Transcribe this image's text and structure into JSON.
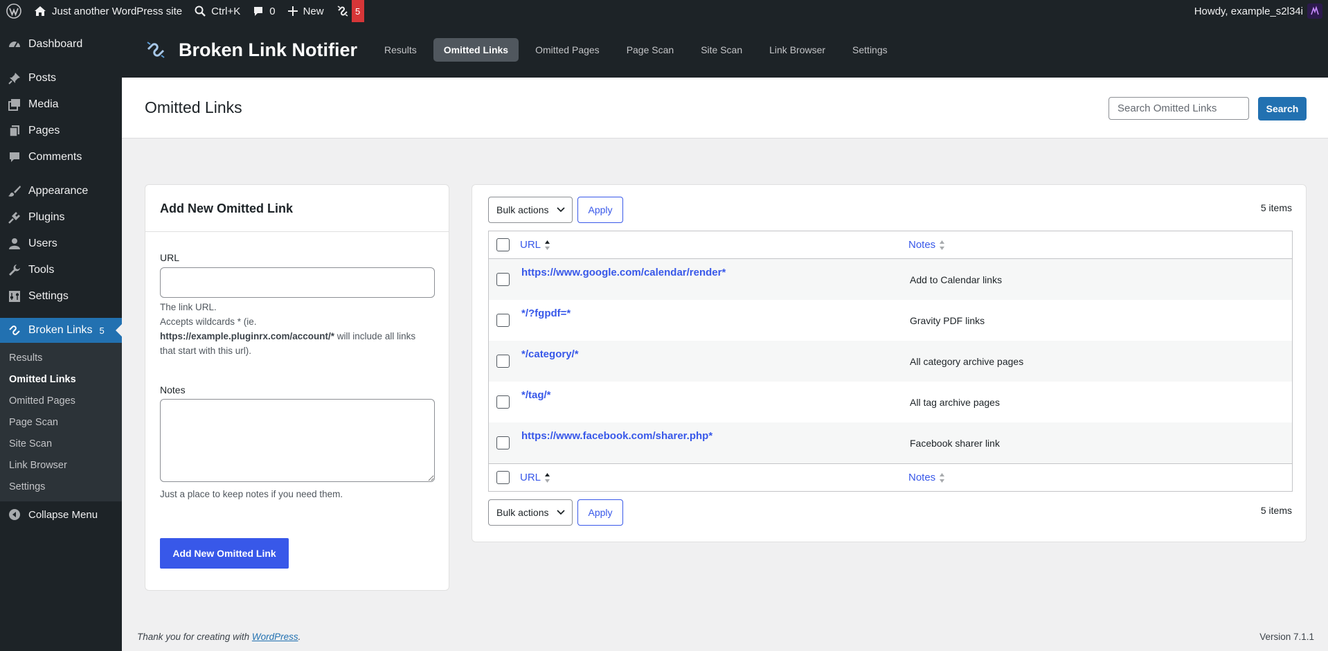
{
  "adminbar": {
    "site_name": "Just another WordPress site",
    "search_shortcut": "Ctrl+K",
    "comments_count": "0",
    "new_label": "New",
    "plugin_badge": "5",
    "howdy": "Howdy, example_s2l34i"
  },
  "menu": {
    "items": [
      {
        "label": "Dashboard",
        "icon": "dashboard-icon"
      },
      {
        "label": "Posts",
        "icon": "pin-icon"
      },
      {
        "label": "Media",
        "icon": "media-icon"
      },
      {
        "label": "Pages",
        "icon": "pages-icon"
      },
      {
        "label": "Comments",
        "icon": "comments-icon"
      },
      {
        "label": "Appearance",
        "icon": "brush-icon"
      },
      {
        "label": "Plugins",
        "icon": "plug-icon"
      },
      {
        "label": "Users",
        "icon": "user-icon"
      },
      {
        "label": "Tools",
        "icon": "wrench-icon"
      },
      {
        "label": "Settings",
        "icon": "sliders-icon"
      }
    ],
    "current": {
      "label": "Broken Links",
      "count": "5"
    },
    "submenu": [
      "Results",
      "Omitted Links",
      "Omitted Pages",
      "Page Scan",
      "Site Scan",
      "Link Browser",
      "Settings"
    ],
    "collapse": "Collapse Menu"
  },
  "plugin_header": {
    "title": "Broken Link Notifier",
    "tabs": [
      "Results",
      "Omitted Links",
      "Omitted Pages",
      "Page Scan",
      "Site Scan",
      "Link Browser",
      "Settings"
    ],
    "active_tab": "Omitted Links"
  },
  "page": {
    "title": "Omitted Links",
    "search_placeholder": "Search Omitted Links",
    "search_button": "Search"
  },
  "form": {
    "heading": "Add New Omitted Link",
    "url_label": "URL",
    "url_help_1": "The link URL.",
    "url_help_2": "Accepts wildcards * (ie.",
    "url_help_example": "https://example.pluginrx.com/account/*",
    "url_help_3": " will include all links that start with this url).",
    "notes_label": "Notes",
    "notes_help": "Just a place to keep notes if you need them.",
    "submit": "Add New Omitted Link"
  },
  "table": {
    "bulk_actions": "Bulk actions",
    "apply": "Apply",
    "items_count": "5 items",
    "columns": {
      "url": "URL",
      "notes": "Notes"
    },
    "rows": [
      {
        "url": "https://www.google.com/calendar/render*",
        "notes": "Add to Calendar links"
      },
      {
        "url": "*/?fgpdf=*",
        "notes": "Gravity PDF links"
      },
      {
        "url": "*/category/*",
        "notes": "All category archive pages"
      },
      {
        "url": "*/tag/*",
        "notes": "All tag archive pages"
      },
      {
        "url": "https://www.facebook.com/sharer.php*",
        "notes": "Facebook sharer link"
      }
    ]
  },
  "footer": {
    "thanks_prefix": "Thank you for creating with ",
    "thanks_link": "WordPress",
    "thanks_suffix": ".",
    "version": "Version 7.1.1"
  },
  "colors": {
    "admin_dark": "#1d2327",
    "wp_blue": "#2271b1",
    "link_blue": "#3858e9",
    "badge_red": "#d63638"
  }
}
